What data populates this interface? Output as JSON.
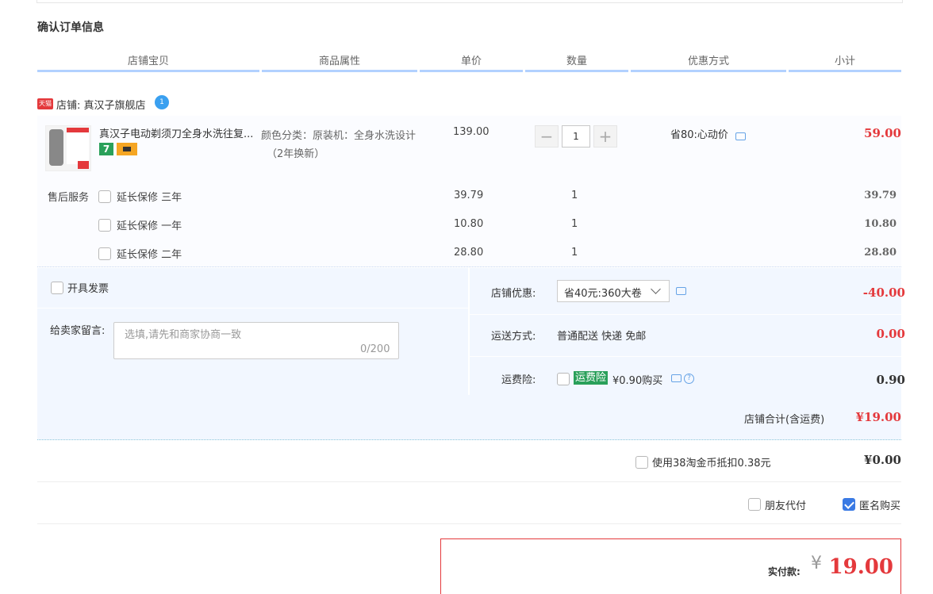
{
  "section_title": "确认订单信息",
  "columns": [
    "店铺宝贝",
    "商品属性",
    "单价",
    "数量",
    "优惠方式",
    "小计"
  ],
  "shop": {
    "badge": "天猫",
    "label": "店铺: 真汉子旗舰店",
    "wangwang_count": "1"
  },
  "item": {
    "title": "真汉子电动剃须刀全身水洗往复...",
    "badge_text": "7",
    "attr_line1": "颜色分类：原装机：全身水洗设计",
    "attr_line2": "（2年换新）",
    "price": "139.00",
    "qty": "1",
    "discount": "省80:心动价",
    "subtotal": "59.00"
  },
  "after_sales": {
    "label": "售后服务",
    "options": [
      {
        "name": "延长保修 三年",
        "price": "39.79",
        "qty": "1",
        "subtotal": "39.79"
      },
      {
        "name": "延长保修 一年",
        "price": "10.80",
        "qty": "1",
        "subtotal": "10.80"
      },
      {
        "name": "延长保修 二年",
        "price": "28.80",
        "qty": "1",
        "subtotal": "28.80"
      }
    ]
  },
  "invoice_label": "开具发票",
  "message": {
    "label": "给卖家留言:",
    "placeholder": "选填,请先和商家协商一致",
    "counter": "0/200"
  },
  "shop_discount": {
    "label": "店铺优惠:",
    "value": "省40元:360大卷",
    "amount": "-40.00"
  },
  "shipping": {
    "label": "运送方式:",
    "value": "普通配送 快递 免邮",
    "amount": "0.00"
  },
  "insurance": {
    "label": "运费险:",
    "tag": "运费险",
    "desc": "¥0.90购买",
    "amount": "0.90"
  },
  "shop_total": {
    "label": "店铺合计(含运费)",
    "amount": "¥19.00"
  },
  "coins": {
    "label": "使用38淘金币抵扣0.38元",
    "amount": "¥0.00"
  },
  "friend_pay": "朋友代付",
  "anonymous": "匿名购买",
  "payment": {
    "label": "实付款:",
    "currency": "¥",
    "amount": "19.00"
  },
  "colors": {
    "accent_red": "#e4393c",
    "header_line": "#b2d1ff",
    "panel_bg": "#f2f7ff",
    "checkbox_blue": "#3a7ae4"
  }
}
